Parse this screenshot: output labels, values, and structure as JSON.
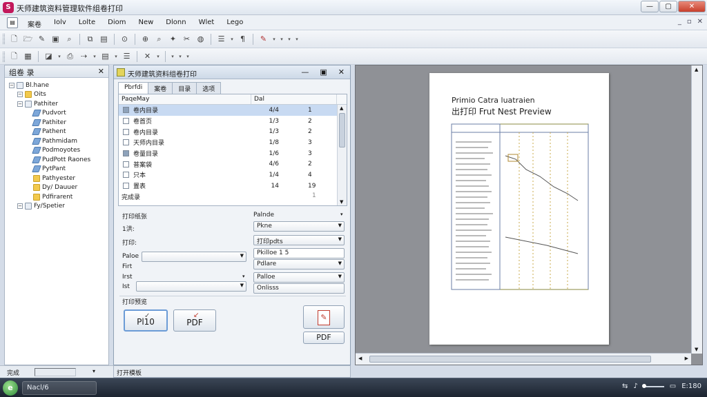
{
  "window": {
    "title": "天师建筑资料管理软件组卷打印"
  },
  "menu": {
    "items": [
      "案卷",
      "Iolv",
      "Lolte",
      "Diom",
      "New",
      "Dlonn",
      "Wlet",
      "Lego"
    ]
  },
  "tree": {
    "title": "组卷 录",
    "items": [
      {
        "label": "Bl.hane",
        "level": 0,
        "icon": "doc-icon"
      },
      {
        "label": "Oits",
        "level": 1,
        "icon": "folder-icon"
      },
      {
        "label": "Pathiter",
        "level": 1,
        "icon": "doc-icon"
      },
      {
        "label": "Pudvort",
        "level": 2,
        "icon": "pen-icon"
      },
      {
        "label": "Pathiter",
        "level": 2,
        "icon": "pen-icon"
      },
      {
        "label": "Pathent",
        "level": 2,
        "icon": "pen-icon"
      },
      {
        "label": "Pathmidam",
        "level": 2,
        "icon": "pen-icon"
      },
      {
        "label": "Podmoyotes",
        "level": 2,
        "icon": "pen-icon"
      },
      {
        "label": "PudPott Raones",
        "level": 2,
        "icon": "pen-icon"
      },
      {
        "label": "PytPant",
        "level": 2,
        "icon": "pen-icon"
      },
      {
        "label": "Pathyester",
        "level": 2,
        "icon": "folder-icon"
      },
      {
        "label": "Dy/ Dauuer",
        "level": 2,
        "icon": "folder-icon"
      },
      {
        "label": "Pdfirarent",
        "level": 2,
        "icon": "folder-icon"
      },
      {
        "label": "Fy/Spetier",
        "level": 1,
        "icon": "doc-icon"
      }
    ]
  },
  "dialog": {
    "title": "天师建筑资料组卷打印",
    "tabs": [
      "Pbrfdi",
      "案卷",
      "目录",
      "选项"
    ],
    "columns": [
      "PaqeMay",
      "Dal"
    ],
    "rows": [
      {
        "name": "卷内目录",
        "count": "4/4",
        "pages": "1",
        "checked": true,
        "selected": true
      },
      {
        "name": "卷首页",
        "count": "1/3",
        "pages": "2",
        "checked": false,
        "selected": false
      },
      {
        "name": "卷内目录",
        "count": "1/3",
        "pages": "2",
        "checked": false,
        "selected": false
      },
      {
        "name": "天师内目录",
        "count": "1/8",
        "pages": "3",
        "checked": false,
        "selected": false
      },
      {
        "name": "卷量目录",
        "count": "1/6",
        "pages": "3",
        "checked": true,
        "selected": false
      },
      {
        "name": "普案袋",
        "count": "4/6",
        "pages": "2",
        "checked": false,
        "selected": false
      },
      {
        "name": "只本",
        "count": "1/4",
        "pages": "4",
        "checked": false,
        "selected": false
      },
      {
        "name": "置表",
        "count": "14",
        "pages": "19",
        "checked": false,
        "selected": false
      }
    ],
    "list_footer": "完成录",
    "list_footer_value": "1",
    "printer_label": "打印纸张",
    "size_label": "1洪:",
    "print_label": "打印:",
    "pages_label": "Paloe",
    "pages_label2": "Firt",
    "label_b": "Irst",
    "label_c": "Ist",
    "right_label": "Palnde",
    "right_options": [
      "Pkne",
      "打印pdts",
      "Pkilloe 1 5",
      "Pdlare",
      "Palloe",
      "Onlisss"
    ],
    "section_label": "打印预览",
    "print_button": "Pl10",
    "pdf_button": "PDF",
    "export_pdf_label": "PDF",
    "status": "打开模板"
  },
  "preview": {
    "line1": "Primio Catra luatraien",
    "line2": "出打印 Frut Nest Preview"
  },
  "statusbar": {
    "text": "完成"
  },
  "taskbar": {
    "task": "Nacl/6",
    "time": "E:180"
  }
}
